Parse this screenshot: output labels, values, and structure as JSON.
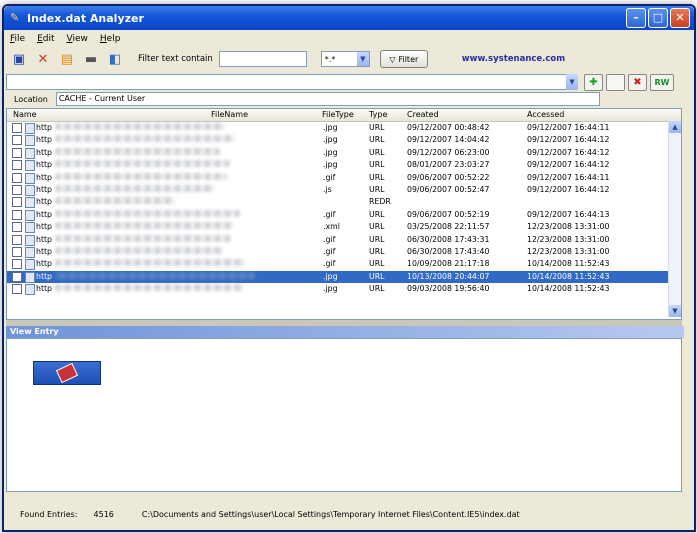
{
  "window": {
    "title": "Index.dat Analyzer"
  },
  "menu": [
    "File",
    "Edit",
    "View",
    "Help"
  ],
  "toolbar": {
    "filter_label": "Filter text contain",
    "filter_value": "",
    "filter_combo": "*.*",
    "filter_button": "Filter",
    "website": "www.systenance.com"
  },
  "address": {
    "value": "",
    "rw_label": "RW"
  },
  "location": {
    "label": "Location",
    "value": "CACHE - Current User"
  },
  "columns": {
    "name": "Name",
    "filename": "FileName",
    "filetype": "FileType",
    "type": "Type",
    "created": "Created",
    "accessed": "Accessed"
  },
  "rows": [
    {
      "name": "http",
      "filetype": ".jpg",
      "type": "URL",
      "created": "09/12/2007   00:48:42",
      "accessed": "09/12/2007   16:44:11"
    },
    {
      "name": "http",
      "filetype": ".jpg",
      "type": "URL",
      "created": "09/12/2007   14:04:42",
      "accessed": "09/12/2007   16:44:12"
    },
    {
      "name": "http",
      "filetype": ".jpg",
      "type": "URL",
      "created": "09/12/2007   06:23:00",
      "accessed": "09/12/2007   16:44:12"
    },
    {
      "name": "http",
      "filetype": ".jpg",
      "type": "URL",
      "created": "08/01/2007   23:03:27",
      "accessed": "09/12/2007   16:44:12"
    },
    {
      "name": "http",
      "filetype": ".gif",
      "type": "URL",
      "created": "09/06/2007   00:52:22",
      "accessed": "09/12/2007   16:44:11"
    },
    {
      "name": "http",
      "filetype": ".js",
      "type": "URL",
      "created": "09/06/2007   00:52:47",
      "accessed": "09/12/2007   16:44:12"
    },
    {
      "name": "http",
      "filetype": "",
      "type": "REDR",
      "created": "",
      "accessed": ""
    },
    {
      "name": "http",
      "filetype": ".gif",
      "type": "URL",
      "created": "09/06/2007   00:52:19",
      "accessed": "09/12/2007   16:44:13"
    },
    {
      "name": "http",
      "filetype": ".xml",
      "type": "URL",
      "created": "03/25/2008   22:11:57",
      "accessed": "12/23/2008   13:31:00"
    },
    {
      "name": "http",
      "filetype": ".gif",
      "type": "URL",
      "created": "06/30/2008   17:43:31",
      "accessed": "12/23/2008   13:31:00"
    },
    {
      "name": "http",
      "filetype": ".gif",
      "type": "URL",
      "created": "06/30/2008   17:43:40",
      "accessed": "12/23/2008   13:31:00"
    },
    {
      "name": "http",
      "filetype": ".gif",
      "type": "URL",
      "created": "10/09/2008   21:17:18",
      "accessed": "10/14/2008   11:52:43"
    },
    {
      "name": "http",
      "filetype": ".jpg",
      "type": "URL",
      "created": "10/13/2008   20:44:07",
      "accessed": "10/14/2008   11:52:43",
      "selected": true
    },
    {
      "name": "http",
      "filetype": ".jpg",
      "type": "URL",
      "created": "09/03/2008   19:56:40",
      "accessed": "10/14/2008   11:52:43"
    }
  ],
  "view_entry": {
    "title": "View Entry"
  },
  "status": {
    "found_label": "Found Entries:",
    "found_count": "4516",
    "path": "C:\\Documents and Settings\\user\\Local Settings\\Temporary Internet Files\\Content.IE5\\index.dat"
  },
  "colors": {
    "title_bar": "#1656d8",
    "selection": "#316ac5",
    "window_bg": "#ece9d8"
  }
}
